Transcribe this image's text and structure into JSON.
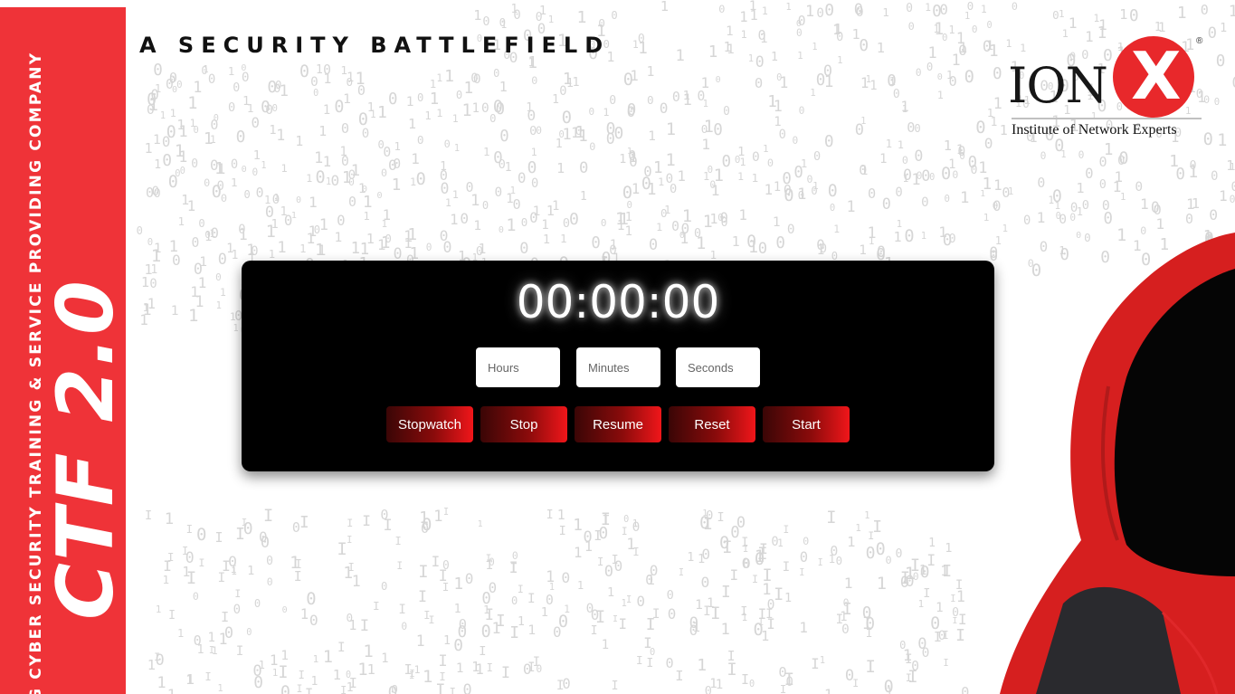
{
  "sidebar": {
    "tagline": "G CYBER SECURITY TRAINING & SERVICE PROVIDING COMPANY",
    "title": "CTF 2.0",
    "color": "#ef3338"
  },
  "heading": "A SECURITY BATTLEFIELD",
  "logo": {
    "wordmark": "ION",
    "mark": "X",
    "registered": "®",
    "tagline": "Institute of Network Experts",
    "accent": "#e8282b"
  },
  "timer": {
    "display": "00:00:00",
    "inputs": {
      "hours_placeholder": "Hours",
      "minutes_placeholder": "Minutes",
      "seconds_placeholder": "Seconds"
    },
    "buttons": {
      "stopwatch": "Stopwatch",
      "stop": "Stop",
      "resume": "Resume",
      "reset": "Reset",
      "start": "Start"
    }
  },
  "colors": {
    "panel": "#000000",
    "button_gradient_start": "#3a0606",
    "button_gradient_end": "#f0161a",
    "hoodie": "#d61f1f"
  }
}
